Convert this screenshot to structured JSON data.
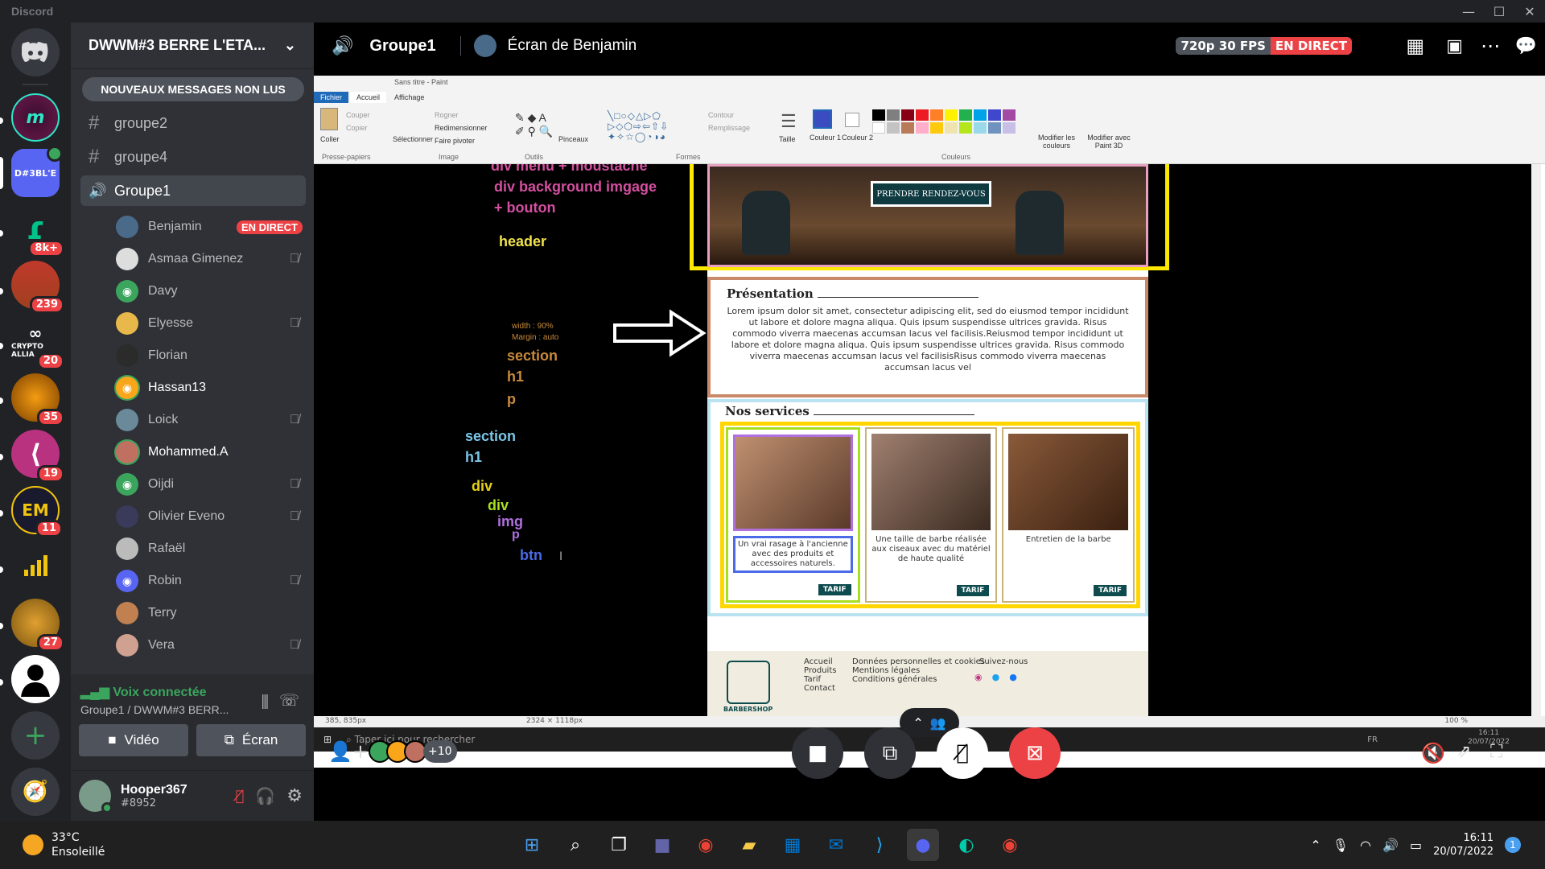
{
  "window": {
    "app_name": "Discord"
  },
  "server": {
    "name": "DWWM#3 BERRE L'ETA...",
    "unread_label": "NOUVEAUX MESSAGES NON LUS"
  },
  "guild_badges": [
    "8k+",
    "239",
    "20",
    "35",
    "19",
    "11",
    "27"
  ],
  "guild_labels": {
    "current": "D#3BL'E",
    "crypto": "CRYPTO ALLIA",
    "em": "EM"
  },
  "channels": [
    {
      "type": "text",
      "name": "groupe2"
    },
    {
      "type": "text",
      "name": "groupe4"
    },
    {
      "type": "voice",
      "name": "Groupe1"
    }
  ],
  "voice_users": [
    {
      "name": "Benjamin",
      "live": "EN DIRECT",
      "muted": false
    },
    {
      "name": "Asmaa Gimenez",
      "muted": true
    },
    {
      "name": "Davy",
      "muted": false
    },
    {
      "name": "Elyesse",
      "muted": true
    },
    {
      "name": "Florian",
      "muted": false
    },
    {
      "name": "Hassan13",
      "muted": false
    },
    {
      "name": "Loick",
      "muted": true
    },
    {
      "name": "Mohammed.A",
      "muted": false
    },
    {
      "name": "Oijdi",
      "muted": true
    },
    {
      "name": "Olivier Eveno",
      "muted": true
    },
    {
      "name": "Rafaël",
      "muted": false
    },
    {
      "name": "Robin",
      "muted": true
    },
    {
      "name": "Terry",
      "muted": false
    },
    {
      "name": "Vera",
      "muted": true
    }
  ],
  "voice_panel": {
    "status": "Voix connectée",
    "location": "Groupe1 / DWWM#3 BERR...",
    "video_label": "Vidéo",
    "screen_label": "Écran"
  },
  "user": {
    "name": "Hooper367",
    "tag": "#8952"
  },
  "stage": {
    "channel": "Groupe1",
    "stream_title": "Écran de Benjamin",
    "quality": "720p 30 FPS",
    "live": "EN DIRECT",
    "participants_more": "+10"
  },
  "paint": {
    "title": "Sans titre - Paint",
    "tabs": [
      "Fichier",
      "Accueil",
      "Affichage"
    ],
    "groups": [
      "Presse-papiers",
      "Image",
      "Outils",
      "Formes",
      "Couleurs"
    ],
    "clipboard": [
      "Coller",
      "Couper",
      "Copier"
    ],
    "image": [
      "Sélectionner",
      "Rogner",
      "Redimensionner",
      "Faire pivoter"
    ],
    "tools": [
      "Pinceaux"
    ],
    "shapes": [
      "Contour",
      "Remplissage"
    ],
    "colors": [
      "Taille",
      "Couleur 1",
      "Couleur 2",
      "Modifier les couleurs",
      "Modifier avec Paint 3D"
    ],
    "status_pos": "385, 835px",
    "status_size": "2324 × 1118px",
    "zoom": "100 %"
  },
  "annotations": {
    "menu": "div menu + moustache",
    "bg": "div background imgage",
    "bouton": "+ bouton",
    "header": "header",
    "width": "width : 90%",
    "margin": "Margin : auto",
    "section1": "section",
    "h1a": "h1",
    "p1": "p",
    "section2": "section",
    "h1b": "h1",
    "div1": "div",
    "div2": "div",
    "img": "img",
    "p2": "p",
    "btn": "btn"
  },
  "website": {
    "cta": "PRENDRE RENDEZ-VOUS",
    "presentation_title": "Présentation",
    "presentation_text": "Lorem ipsum dolor sit amet, consectetur adipiscing elit, sed do eiusmod tempor incididunt ut labore et dolore magna aliqua. Quis ipsum suspendisse ultrices gravida. Risus commodo viverra maecenas accumsan lacus vel facilisis.Reiusmod tempor incididunt ut labore et dolore magna aliqua. Quis ipsum suspendisse ultrices gravida. Risus commodo viverra maecenas accumsan lacus vel facilisisRisus commodo viverra maecenas accumsan lacus vel",
    "services_title": "Nos services",
    "services": [
      {
        "caption": "Un vrai rasage à l'ancienne avec des produits et accessoires naturels.",
        "button": "TARIF"
      },
      {
        "caption": "Une taille de barbe réalisée aux ciseaux avec du matériel de haute qualité",
        "button": "TARIF"
      },
      {
        "caption": "Entretien de la barbe",
        "button": "TARIF"
      }
    ],
    "footer_col1": [
      "Accueil",
      "Produits",
      "Tarif",
      "Contact"
    ],
    "footer_col2": [
      "Données personnelles et cookies",
      "Mentions légales",
      "Conditions générales"
    ],
    "footer_col3": "Suivez-nous",
    "brand": "BARBERSHOP"
  },
  "remote_taskbar": {
    "search": "Taper ici pour rechercher",
    "lang": "FR",
    "time": "16:11",
    "date": "20/07/2022"
  },
  "taskbar": {
    "weather_temp": "33°C",
    "weather_desc": "Ensoleillé",
    "time": "16:11",
    "date": "20/07/2022",
    "notif": "1"
  }
}
